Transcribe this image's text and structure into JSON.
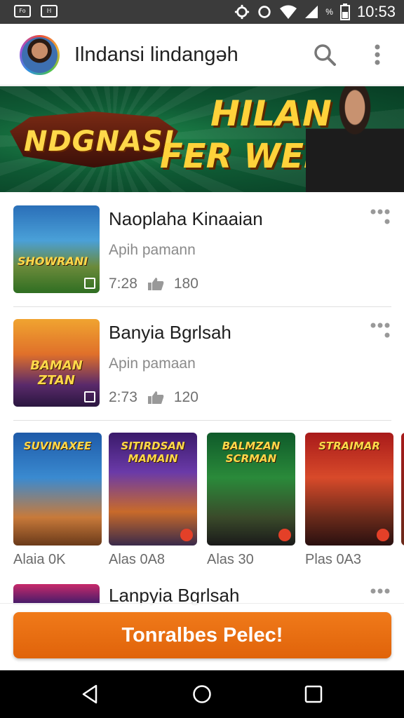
{
  "status_bar": {
    "notifications": [
      "Fo",
      "ℍ"
    ],
    "battery_percent_label": "%",
    "time": "10:53"
  },
  "app_bar": {
    "title": "Ilndansi lindangəh"
  },
  "banner": {
    "text_left": "NDGNASI",
    "text_right_line1": "HILAN",
    "text_right_line2": "FER WENIN"
  },
  "list": [
    {
      "title": "Naoplaha Kinaaian",
      "subtitle": "Apih pamann",
      "duration": "7:28",
      "likes": "180",
      "thumb_text": "SHOWRANI"
    },
    {
      "title": "Banyia Bgrlsah",
      "subtitle": "Apin pamaan",
      "duration": "2:73",
      "likes": "120",
      "thumb_text": "BAMAN ZTAN"
    }
  ],
  "carousel": [
    {
      "title_art": "SUVINAXEE",
      "label": "Alaia 0K"
    },
    {
      "title_art": "SITIRDSAN MAMAIN",
      "label": "Alas 0A8"
    },
    {
      "title_art": "BALMZAN SCRMAN",
      "label": "Alas 30"
    },
    {
      "title_art": "STRAIMAR",
      "label": "Plas 0A3"
    }
  ],
  "partial_item": {
    "title": "Lanpyia Bgrlsah"
  },
  "cta": {
    "label": "Tonralbes Pelec!"
  },
  "colors": {
    "accent_orange": "#e8700f",
    "status_bar": "#3b3b3b",
    "nav_bar": "#000000"
  },
  "icons": [
    "search-icon",
    "more-vertical-icon",
    "more-horizontal-icon",
    "thumbs-up-icon",
    "back-icon",
    "home-icon",
    "recents-icon",
    "gear-icon",
    "wifi-icon",
    "battery-icon"
  ]
}
